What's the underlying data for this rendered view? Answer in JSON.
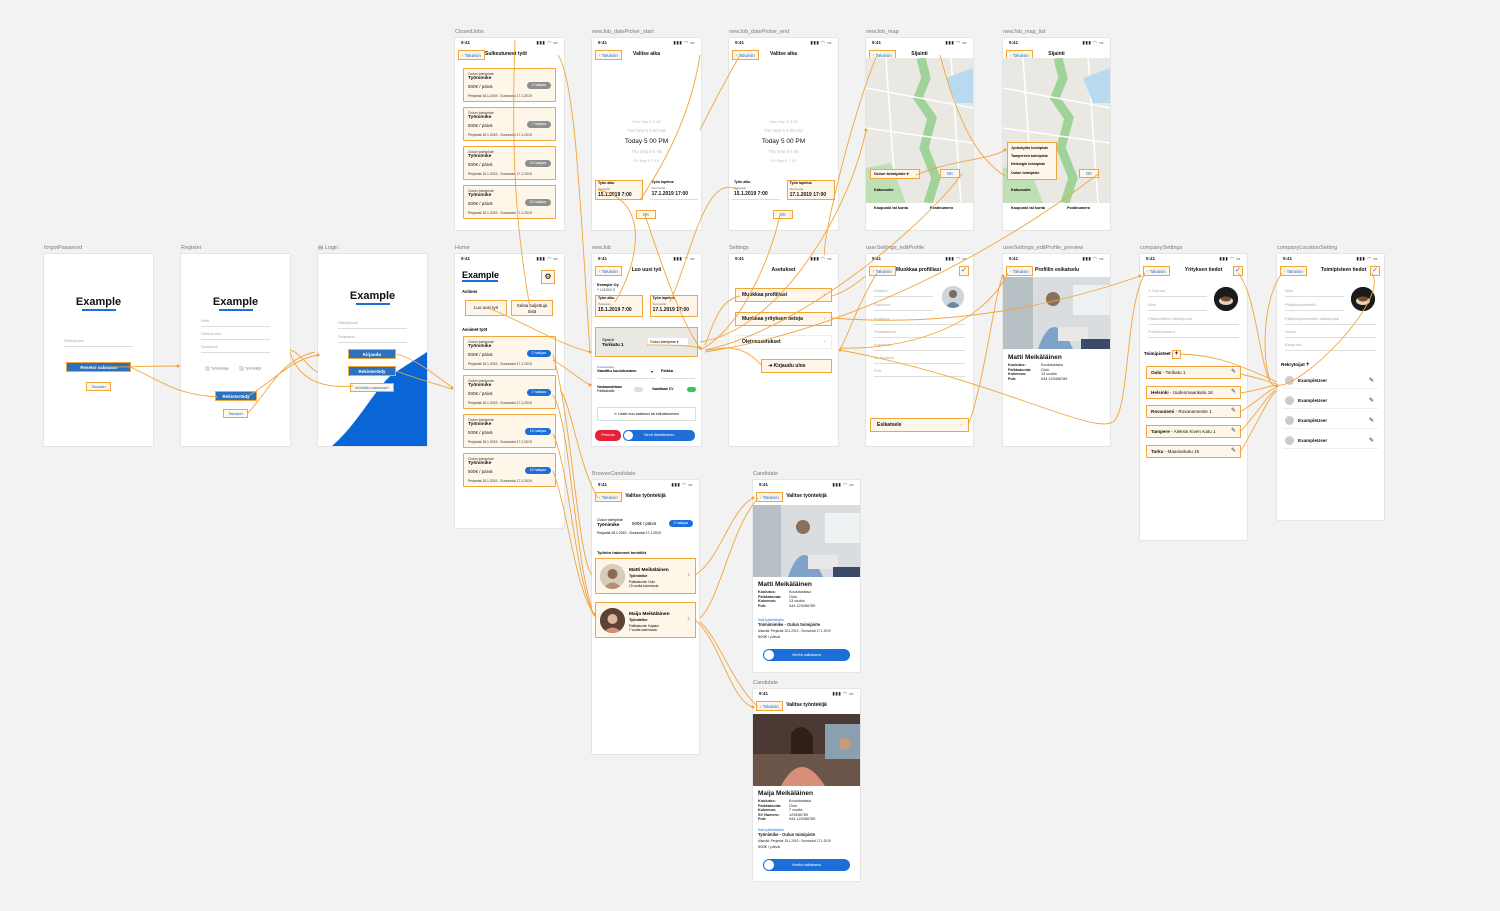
{
  "common": {
    "time": "9:41",
    "back": "Takaisin",
    "status_icons": "▮▮▮ ◠ ▭",
    "check": "✓",
    "chevron": "›",
    "edit": "✎"
  },
  "labels": {
    "forgot": "forgotPassword",
    "register": "Register",
    "login": "Login",
    "home": "Home",
    "closed": "ClosedJobs",
    "dp_start": "newJob_datePicker_start",
    "dp_end": "newJob_datePicker_end",
    "map": "newJob_map",
    "map_list": "newJob_map_list",
    "newjob": "newJob",
    "settings": "Settings",
    "edit_profile": "userSettings_editProfile",
    "edit_profile_preview": "userSettings_editProfile_preview",
    "company_settings": "companySettings",
    "company_location": "companyLocationSetting",
    "browse": "BrowseCandidate",
    "candidate1": "Candidate",
    "candidate2": "Candidate"
  },
  "brand": "Example",
  "forgot": {
    "field": "Sähköposti",
    "button": "Resetoi salasana",
    "back": "Takaisin"
  },
  "register": {
    "f1": "Nimi",
    "f2": "Sähköposti",
    "f3": "Salasana",
    "opt1": "Työnantaja",
    "opt2": "Työntekijä",
    "button": "Rekisteröidy",
    "back": "Takaisin"
  },
  "login": {
    "f1": "Sähköposti",
    "f2": "Salasana",
    "b1": "Kirjaudu",
    "b2": "Rekisteröidy",
    "b3": "Unohditko salasanasi?"
  },
  "home": {
    "actions": "Actions",
    "a1": "Luo uusi työ",
    "a2": "Selaa suljettuja töitä",
    "open": "Avoimet työt",
    "gear": "⚙"
  },
  "jobs": [
    {
      "place": "Oulun toimipiste",
      "title": "Työnimike",
      "pay": "500€ / päivä",
      "dates": "Perjantai 15.1.2019 - Sunnuntai 17.1.2019",
      "count": "2 hakijaa"
    },
    {
      "place": "Oulun toimipiste",
      "title": "Työnimike",
      "pay": "500€ / päivä",
      "dates": "Perjantai 15.1.2019 - Sunnuntai 17.1.2019",
      "count": "7 hakijaa"
    },
    {
      "place": "Oulun toimipiste",
      "title": "Työnimike",
      "pay": "500€ / päivä",
      "dates": "Perjantai 15.1.2019 - Sunnuntai 17.1.2019",
      "count": "15 hakijaa"
    },
    {
      "place": "Oulun toimipiste",
      "title": "Työnimike",
      "pay": "500€ / päivä",
      "dates": "Perjantai 15.1.2019 - Sunnuntai 17.1.2019",
      "count": "15 hakijaa"
    }
  ],
  "closed": {
    "title": "Sulkeutuneet työt"
  },
  "dp": {
    "title": "Valitse aika",
    "rows": [
      "Mon Sep 5   3   45",
      "Tue Sep 6   4   50   AM",
      "Today   5   00   PM",
      "Thu Sep 8   6   05",
      "Fri Sep 9   7   10"
    ],
    "start_label": "Työn alku",
    "start_sub": "Perjantai",
    "start_val": "15.1.2019   7:00",
    "end_label": "Työn lopetus",
    "end_sub": "Sunnuntai",
    "end_val": "17.1.2019   17:00",
    "ok": "OK"
  },
  "map": {
    "title": "Sijainti",
    "select": "Oulun toimipiste",
    "ok": "OK",
    "f1": "Katuosoite",
    "f2": "Kaupunki tai kunta",
    "f3": "Postinumero",
    "list": [
      "Jyväskylän toimipiste",
      "Tampereen toimipiste",
      "Helsingin toimipiste",
      "Oulun toimipiste"
    ]
  },
  "newjob": {
    "title": "Luo uusi työ",
    "company": "Example Oy",
    "company_id": "Y 1234567-8",
    "loc_label": "Sijainti",
    "loc_val": "Torikatu 1",
    "loc_sel": "Oulun toimipiste",
    "edu_label": "Koulutustaso",
    "edu_val": "Vaadittu koulutustaso",
    "pay": "Palkka",
    "f1": "Vastaanotetaan",
    "f1b": "Palkkakatto",
    "f2": "Vaaditaan CV",
    "add": "Lisää muu vaatimus tai erikoistuminen",
    "cancel": "Peruuta",
    "publish": "Vienä lähettäminen"
  },
  "settings": {
    "title": "Asetukset",
    "m1": "Muokkaa profiiliasi",
    "m2": "Muokkaa yrityksen tietoja",
    "m3": "Oletusasetukset",
    "m4": "Kirjaudu ulos",
    "logout_icon": "⇥"
  },
  "edit_profile": {
    "title": "Muokkaa profiiliasi",
    "fields": [
      "Etunimi",
      "Sukunimi",
      "Koulutus",
      "Paikkakunta",
      "Kokemus",
      "Sv Numero",
      "Puh"
    ],
    "preview": "Esikatsele"
  },
  "preview": {
    "title": "Profiilin esikatselu",
    "name": "Matti Meikäläinen",
    "k": [
      "Koulutus:",
      "Paikkakunta:",
      "Kokemus:",
      "Puh:"
    ],
    "v": [
      "Koulutustaso",
      "Oulu",
      "13 vuotta",
      "044 123456789"
    ]
  },
  "company": {
    "title": "Yrityksen tiedot",
    "fields": [
      "Y-Tunnus",
      "Nimi",
      "Pääosoitteen sähköposti",
      "Puhelinnumero"
    ],
    "offices": "Toimipisteet",
    "plus": "+",
    "locs": [
      {
        "c": "Oulu",
        "s": "Torikatu 1"
      },
      {
        "c": "Helsinki",
        "s": "Uudenmaankatu 16"
      },
      {
        "c": "Rovaniemi",
        "s": "Rovanementie 1"
      },
      {
        "c": "Tampere",
        "s": "Aleksis Kiven Katu 1"
      },
      {
        "c": "Turku",
        "s": "Maariankatu 15"
      }
    ]
  },
  "company_loc": {
    "title": "Toimipisteen tiedot",
    "fields": [
      "Nimi",
      "Pääyhteyshenkilö",
      "Pääyhteyshenkilön sähköposti",
      "Osoite",
      "Kaupunki"
    ],
    "recruiters": "Rekrytoijat",
    "plus": "+",
    "users": [
      "ExampleUser",
      "ExampleUser",
      "ExampleUser",
      "ExampleUser"
    ]
  },
  "browse": {
    "title": "Valitse työntekijä",
    "place": "Oulun toimipiste",
    "job": "Työnimike",
    "pay": "500€ / päivä",
    "count": "2 hakijaa",
    "dates": "Perjantai 15.1.2019 - Sunnuntai 17.1.2019",
    "applicants": "Työhön hakeneet henkilöt",
    "c1": {
      "name": "Matti Meikäläinen",
      "job": "Työnimike",
      "l1": "Paikkakunta: Oulu",
      "l2": "13 vuotta kokemusta"
    },
    "c2": {
      "name": "Maija Meikäläinen",
      "job": "Työnimike",
      "l1": "Paikkakunta: Kajaani",
      "l2": "7 vuotta kokemusta"
    }
  },
  "cand1": {
    "title": "Valitse työntekijä",
    "name": "Matti Meikäläinen",
    "k": [
      "Koulutus:",
      "Paikkakunta:",
      "Kokemus:",
      "Puh:"
    ],
    "v": [
      "Koulutustaso",
      "Oulu",
      "13 vuotta",
      "044 123456789"
    ],
    "applied": "Haki työtehtävään:",
    "job": "Toimimimike - Oulun toimipiste",
    "dates": "Aikaväli: Perjantai 15.1.2019 - Sunnuntai 17.1.2019",
    "pay": "500€ / päivä",
    "slide": "Vieritä valitaksesi"
  },
  "cand2": {
    "title": "Valitse työntekijä",
    "name": "Maija Meikäläinen",
    "k": [
      "Koulutus:",
      "Paikkakunta:",
      "Kokemus:",
      "SV Numero:",
      "Puh:"
    ],
    "v": [
      "Koulutustaso",
      "Oulu",
      "7 vuotta",
      "123456789",
      "044 123456789"
    ],
    "applied": "Haki työtehtävään:",
    "job": "Työnimike - Oulun toimipiste",
    "dates": "Aikaväli: Perjantai 15.1.2019 - Sunnuntai 17.1.2019",
    "pay": "500€ / päivä",
    "slide": "Vieritä valitaksesi"
  },
  "colors": {
    "accent": "#1d6ed6",
    "wire": "#f2a53b",
    "highlight_bg": "#fff6ea",
    "button_blue": "#2b71bd",
    "cancel_red": "#e5213a",
    "canvas": "#f2f2f2"
  }
}
